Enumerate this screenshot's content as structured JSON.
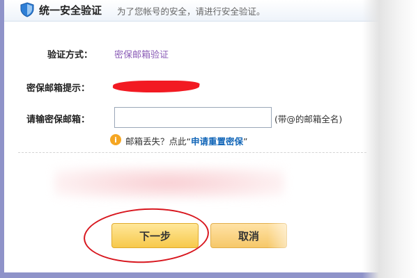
{
  "window": {
    "title": "统一安全验证",
    "subtitle": "为了您帐号的安全，请进行安全验证。"
  },
  "form": {
    "method_label": "验证方式：",
    "method_value": "密保邮箱验证",
    "hint_label": "密保邮箱提示：",
    "email_label": "请输密保邮箱：",
    "email_value": "",
    "email_hint": "(带@的邮箱全名)",
    "lost_text": "邮箱丢失？点此“",
    "lost_link": "申请重置密保",
    "lost_suffix": "”"
  },
  "buttons": {
    "next": "下一步",
    "cancel": "取消"
  },
  "colors": {
    "accent_link": "#1266b8",
    "method_purple": "#8b5db7",
    "button_gold": "#f7c94b",
    "annotation_red": "#d8161e",
    "info_icon": "#f5a623"
  }
}
